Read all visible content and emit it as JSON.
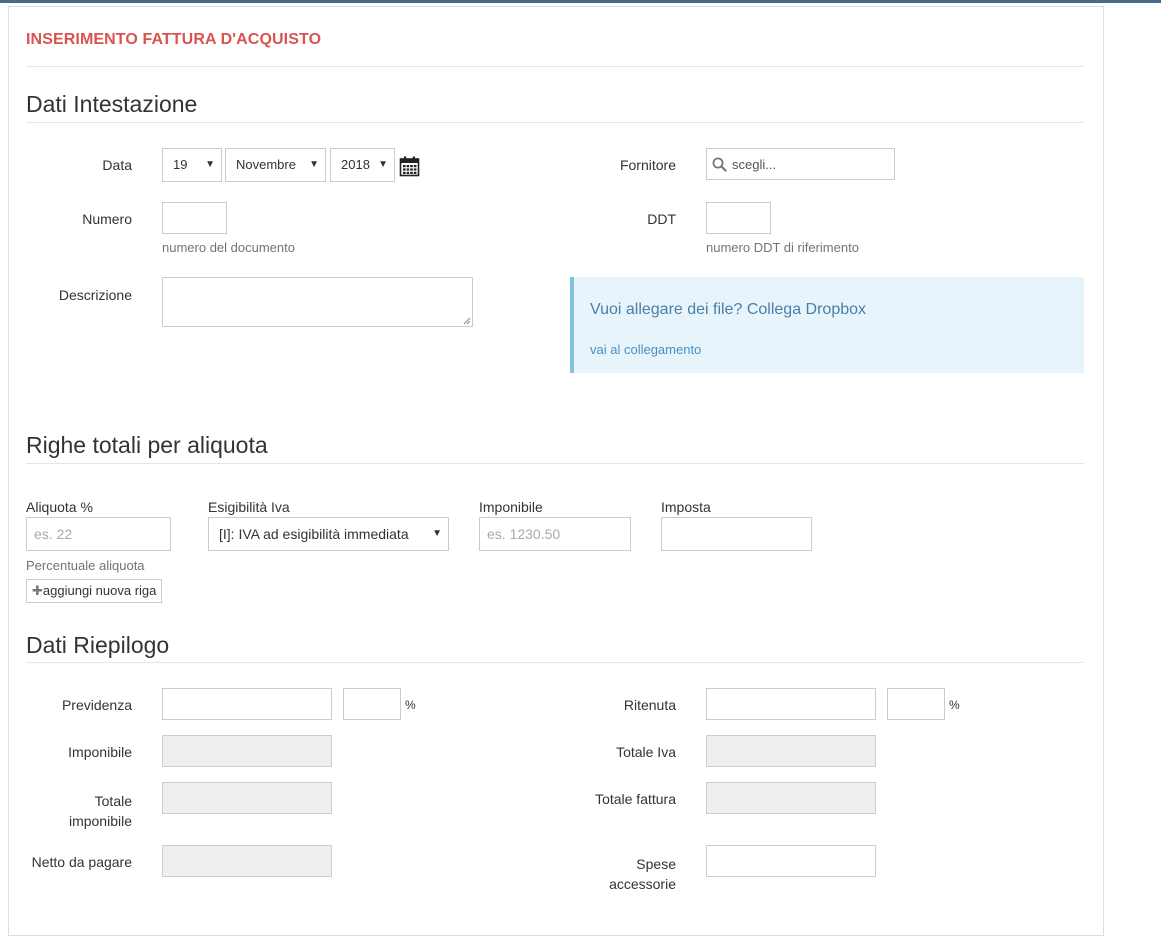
{
  "page": {
    "title": "INSERIMENTO FATTURA D'ACQUISTO"
  },
  "colors": {
    "title": "#d9534f",
    "alert_bg": "#e8f4fb",
    "alert_border": "#84c2e4",
    "link": "#4a8fc1"
  },
  "intestazione": {
    "heading": "Dati Intestazione",
    "data_label": "Data",
    "day": "19",
    "month": "Novembre",
    "year": "2018",
    "calendar_icon": "calendar-icon",
    "fornitore_label": "Fornitore",
    "fornitore_placeholder": "scegli...",
    "numero_label": "Numero",
    "numero_help": "numero del documento",
    "ddt_label": "DDT",
    "ddt_help": "numero DDT di riferimento",
    "descrizione_label": "Descrizione",
    "dropbox_text": "Vuoi allegare dei file? Collega Dropbox",
    "dropbox_link": "vai al collegamento"
  },
  "aliquote": {
    "heading": "Righe totali per aliquota",
    "columns": [
      "Aliquota %",
      "Esigibilità Iva",
      "Imponibile",
      "Imposta"
    ],
    "aliquota_placeholder": "es. 22",
    "esigibilita_value": "[I]: IVA ad esigibilità immediata",
    "imponibile_placeholder": "es. 1230.50",
    "aliquota_help": "Percentuale aliquota",
    "add_row_label": "aggiungi nuova riga"
  },
  "riepilogo": {
    "heading": "Dati Riepilogo",
    "previdenza_label": "Previdenza",
    "ritenuta_label": "Ritenuta",
    "percent": "%",
    "imponibile_label": "Imponibile",
    "totale_iva_label": "Totale Iva",
    "totale_imponibile_label": [
      "Totale",
      "imponibile"
    ],
    "totale_fattura_label": "Totale fattura",
    "netto_label": "Netto da pagare",
    "spese_label": [
      "Spese",
      "accessorie"
    ]
  }
}
